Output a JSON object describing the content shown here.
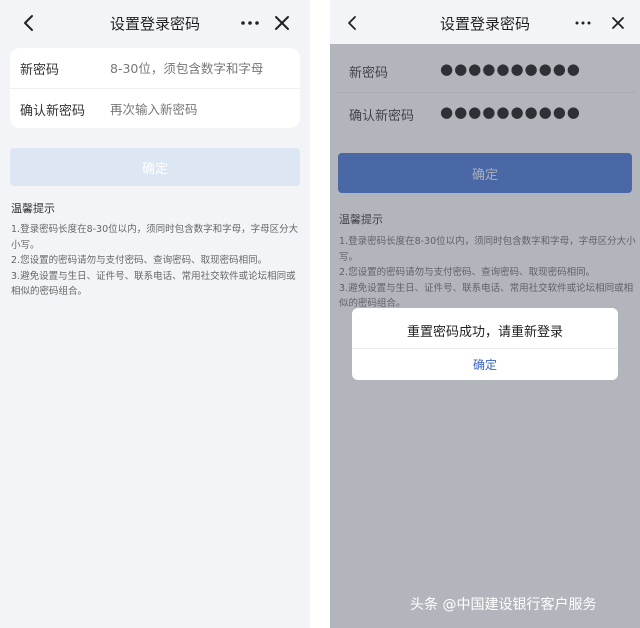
{
  "left_screen": {
    "title": "设置登录密码",
    "form": {
      "password_label": "新密码",
      "password_placeholder": "8-30位，须包含数字和字母",
      "confirm_label": "确认新密码",
      "confirm_placeholder": "再次输入新密码"
    },
    "confirm_button": "确定",
    "tips_title": "温馨提示",
    "tips": [
      "1.登录密码长度在8-30位以内，须同时包含数字和字母，字母区分大小写。",
      "2.您设置的密码请勿与支付密码、查询密码、取现密码相同。",
      "3.避免设置与生日、证件号、联系电话、常用社交软件或论坛相同或相似的密码组合。"
    ]
  },
  "right_screen": {
    "title": "设置登录密码",
    "form": {
      "password_label": "新密码",
      "password_value_masked": "●●●●●●●●●●",
      "confirm_label": "确认新密码",
      "confirm_value_masked": "●●●●●●●●●●"
    },
    "confirm_button": "确定",
    "tips_title": "温馨提示",
    "tips": [
      "1.登录密码长度在8-30位以内，须同时包含数字和字母，字母区分大小写。",
      "2.您设置的密码请勿与支付密码、查询密码、取现密码相同。",
      "3.避免设置与生日、证件号、联系电话、常用社交软件或论坛相同或相似的密码组合。"
    ],
    "dialog": {
      "message": "重置密码成功，请重新登录",
      "button": "确定"
    }
  },
  "watermark": "头条 @中国建设银行客户服务",
  "icons": {
    "back": "chevron-left-icon",
    "more": "more-dots-icon",
    "close": "close-icon"
  },
  "colors": {
    "primary_blue": "#3f6fd1",
    "disabled_button": "#dde6f3",
    "page_background": "#f3f4f7",
    "dialog_link": "#3a64c4"
  }
}
